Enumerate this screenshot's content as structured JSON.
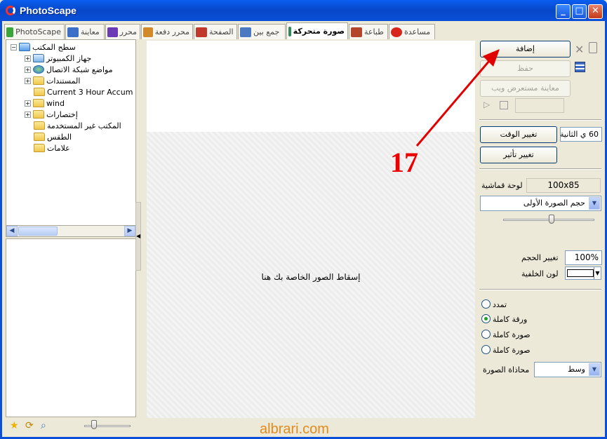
{
  "window": {
    "title": "PhotoScape"
  },
  "tabs": [
    {
      "label": "PhotoScape",
      "color": "#3aa53a"
    },
    {
      "label": "معاينة",
      "color": "#3b6fc8"
    },
    {
      "label": "محرر",
      "color": "#6b3bb5"
    },
    {
      "label": "محرر دفعة",
      "color": "#d08a2a"
    },
    {
      "label": "الصفحة",
      "color": "#c0392b"
    },
    {
      "label": "جمع بين",
      "color": "#4b79c2"
    },
    {
      "label": "صورة متحركة",
      "color": "#2e8b57",
      "active": true
    },
    {
      "label": "طباعة",
      "color": "#b4462c"
    },
    {
      "label": "مساعدة",
      "color": "#d9261c"
    }
  ],
  "tree": {
    "root": "سطح المكتب",
    "items": [
      "جهاز الكمبيوتر",
      "مواضع شبكة الاتصال",
      "المستندات",
      "Current 3 Hour Accum",
      "wind",
      "إختصارات",
      "المكتب غير المستخدمة",
      "الطقس",
      "علامات"
    ]
  },
  "canvas": {
    "drop_text": "إسقاط الصور الخاصة بك هنا"
  },
  "right_panel": {
    "add_label": "إضافة",
    "save_label": "حفظ",
    "web_preview_label": "معاينة مستعرض ويب",
    "change_time_label": "تغيير الوقت",
    "time_value": "60 ي الثانية",
    "change_effect_label": "تغيير تأثير",
    "canvas_label": "لوحة قماشية",
    "canvas_size": "100x85",
    "size_select": "حجم الصورة الأولى",
    "resize_label": "تغيير الحجم",
    "resize_value": "100%",
    "bg_color_label": "لون الخلفية",
    "bg_color": "#ffffff",
    "options": [
      {
        "label": "تمدد",
        "checked": false
      },
      {
        "label": "ورقة كاملة",
        "checked": true
      },
      {
        "label": "صورة كاملة",
        "checked": false
      },
      {
        "label": "صورة كاملة",
        "checked": false
      }
    ],
    "align_label": "محاذاة الصورة",
    "align_value": "وسط"
  },
  "annotation": {
    "number": "17",
    "color": "#e00000"
  },
  "watermark": "albrari.com"
}
